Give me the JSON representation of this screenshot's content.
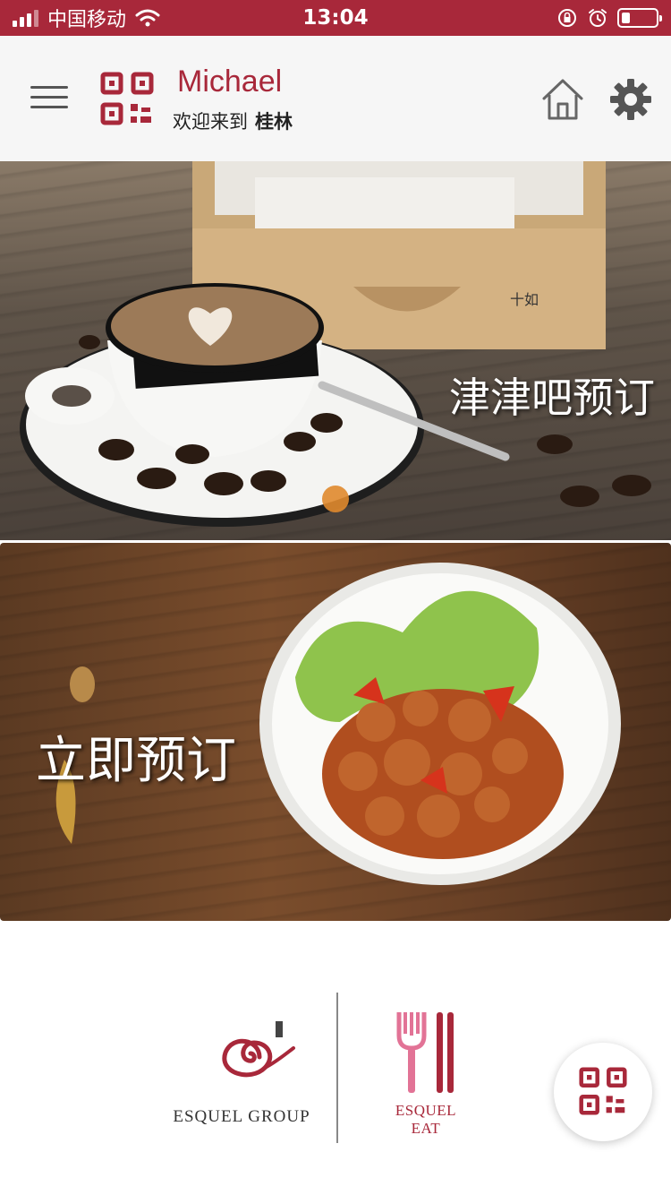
{
  "status_bar": {
    "carrier": "中国移动",
    "time": "13:04"
  },
  "header": {
    "user_name": "Michael",
    "welcome_prefix": "欢迎来到",
    "city": "桂林",
    "icons": [
      "menu-icon",
      "qr-code-icon",
      "home-icon",
      "gear-icon"
    ]
  },
  "banners": [
    {
      "title": "津津吧预订"
    },
    {
      "title": "立即预订"
    }
  ],
  "logos": {
    "group_name": "ESQUEL GROUP",
    "eat_name": "ESQUEL EAT"
  },
  "colors": {
    "brand": "#a8283a",
    "header_bg": "#f6f6f6",
    "carousel_dot": "#e08a2e"
  }
}
